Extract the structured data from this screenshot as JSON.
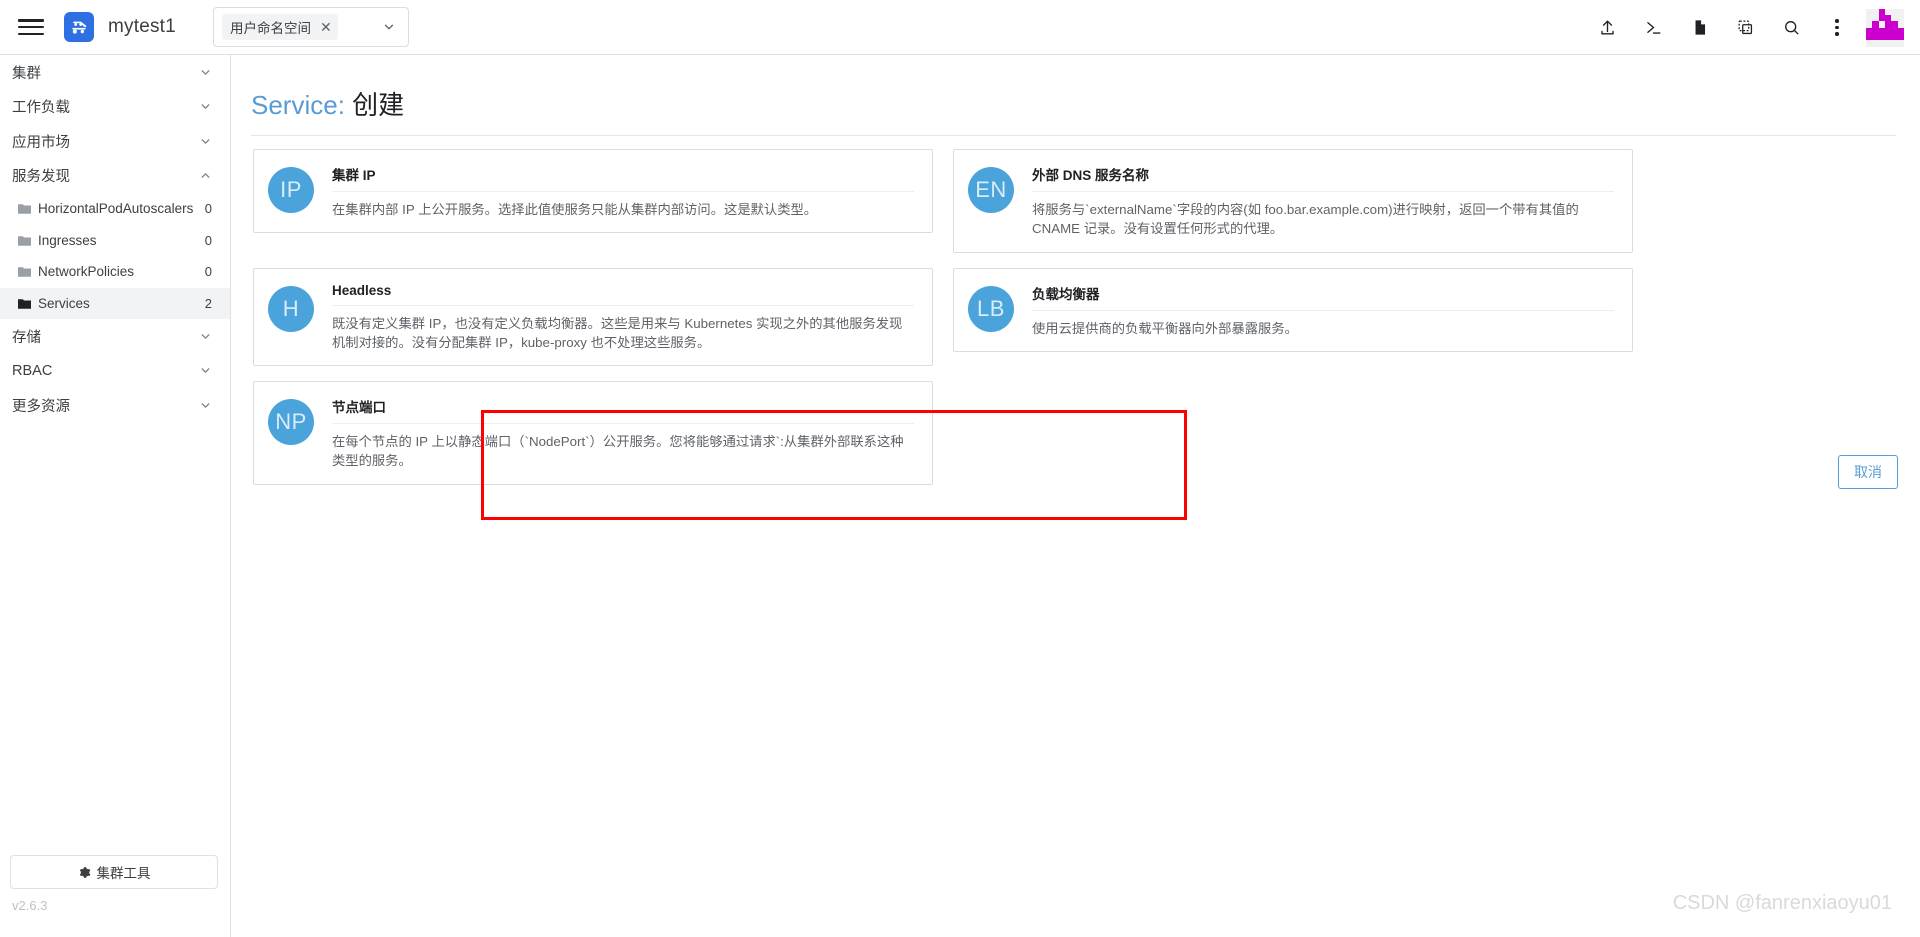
{
  "header": {
    "menu_icon": "hamburger-menu-icon",
    "logo_icon": "app-logo-icon",
    "app_name": "mytest1",
    "namespace": {
      "chip_label": "用户命名空间",
      "chip_remove_icon": "close-icon",
      "caret_icon": "chevron-down-icon"
    },
    "actions": [
      {
        "name": "upload-icon",
        "title": "上传"
      },
      {
        "name": "terminal-icon",
        "title": "终端"
      },
      {
        "name": "document-icon",
        "title": "文档"
      },
      {
        "name": "copy-icon",
        "title": "复制"
      },
      {
        "name": "search-icon",
        "title": "搜索"
      },
      {
        "name": "kebab-menu-icon",
        "title": "更多"
      }
    ],
    "avatar_name": "user-avatar"
  },
  "sidebar": {
    "groups": [
      {
        "label": "集群",
        "expanded": false
      },
      {
        "label": "工作负载",
        "expanded": false
      },
      {
        "label": "应用市场",
        "expanded": false
      },
      {
        "label": "服务发现",
        "expanded": true
      }
    ],
    "service_discovery_items": [
      {
        "label": "HorizontalPodAutoscalers",
        "count": "0",
        "active": false
      },
      {
        "label": "Ingresses",
        "count": "0",
        "active": false
      },
      {
        "label": "NetworkPolicies",
        "count": "0",
        "active": false
      },
      {
        "label": "Services",
        "count": "2",
        "active": true
      }
    ],
    "groups_after": [
      {
        "label": "存储",
        "expanded": false
      },
      {
        "label": "RBAC",
        "expanded": false
      },
      {
        "label": "更多资源",
        "expanded": false
      }
    ],
    "cluster_tools_label": "集群工具",
    "cluster_tools_icon": "gear-icon",
    "version": "v2.6.3"
  },
  "main": {
    "title_prefix": "Service:",
    "title_suffix": "创建",
    "cancel_label": "取消",
    "accent_color": "#5a9bd5",
    "badge_color": "#4aa3db",
    "highlight_color": "#ff0000",
    "cards": [
      {
        "badge": "IP",
        "title": "集群 IP",
        "desc": "在集群内部 IP 上公开服务。选择此值使服务只能从集群内部访问。这是默认类型。",
        "highlighted": false
      },
      {
        "badge": "EN",
        "title": "外部 DNS 服务名称",
        "desc": "将服务与`externalName`字段的内容(如 foo.bar.example.com)进行映射，返回一个带有其值的 CNAME 记录。没有设置任何形式的代理。",
        "highlighted": false
      },
      {
        "badge": "H",
        "title": "Headless",
        "desc": "既没有定义集群 IP，也没有定义负载均衡器。这些是用来与 Kubernetes 实现之外的其他服务发现机制对接的。没有分配集群 IP，kube-proxy 也不处理这些服务。",
        "highlighted": false
      },
      {
        "badge": "LB",
        "title": "负载均衡器",
        "desc": "使用云提供商的负载平衡器向外部暴露服务。",
        "highlighted": false
      },
      {
        "badge": "NP",
        "title": "节点端口",
        "desc": "在每个节点的 IP 上以静态端口（`NodePort`）公开服务。您将能够通过请求`:从集群外部联系这种类型的服务。",
        "highlighted": true
      }
    ]
  },
  "watermark": "CSDN @fanrenxiaoyu01"
}
